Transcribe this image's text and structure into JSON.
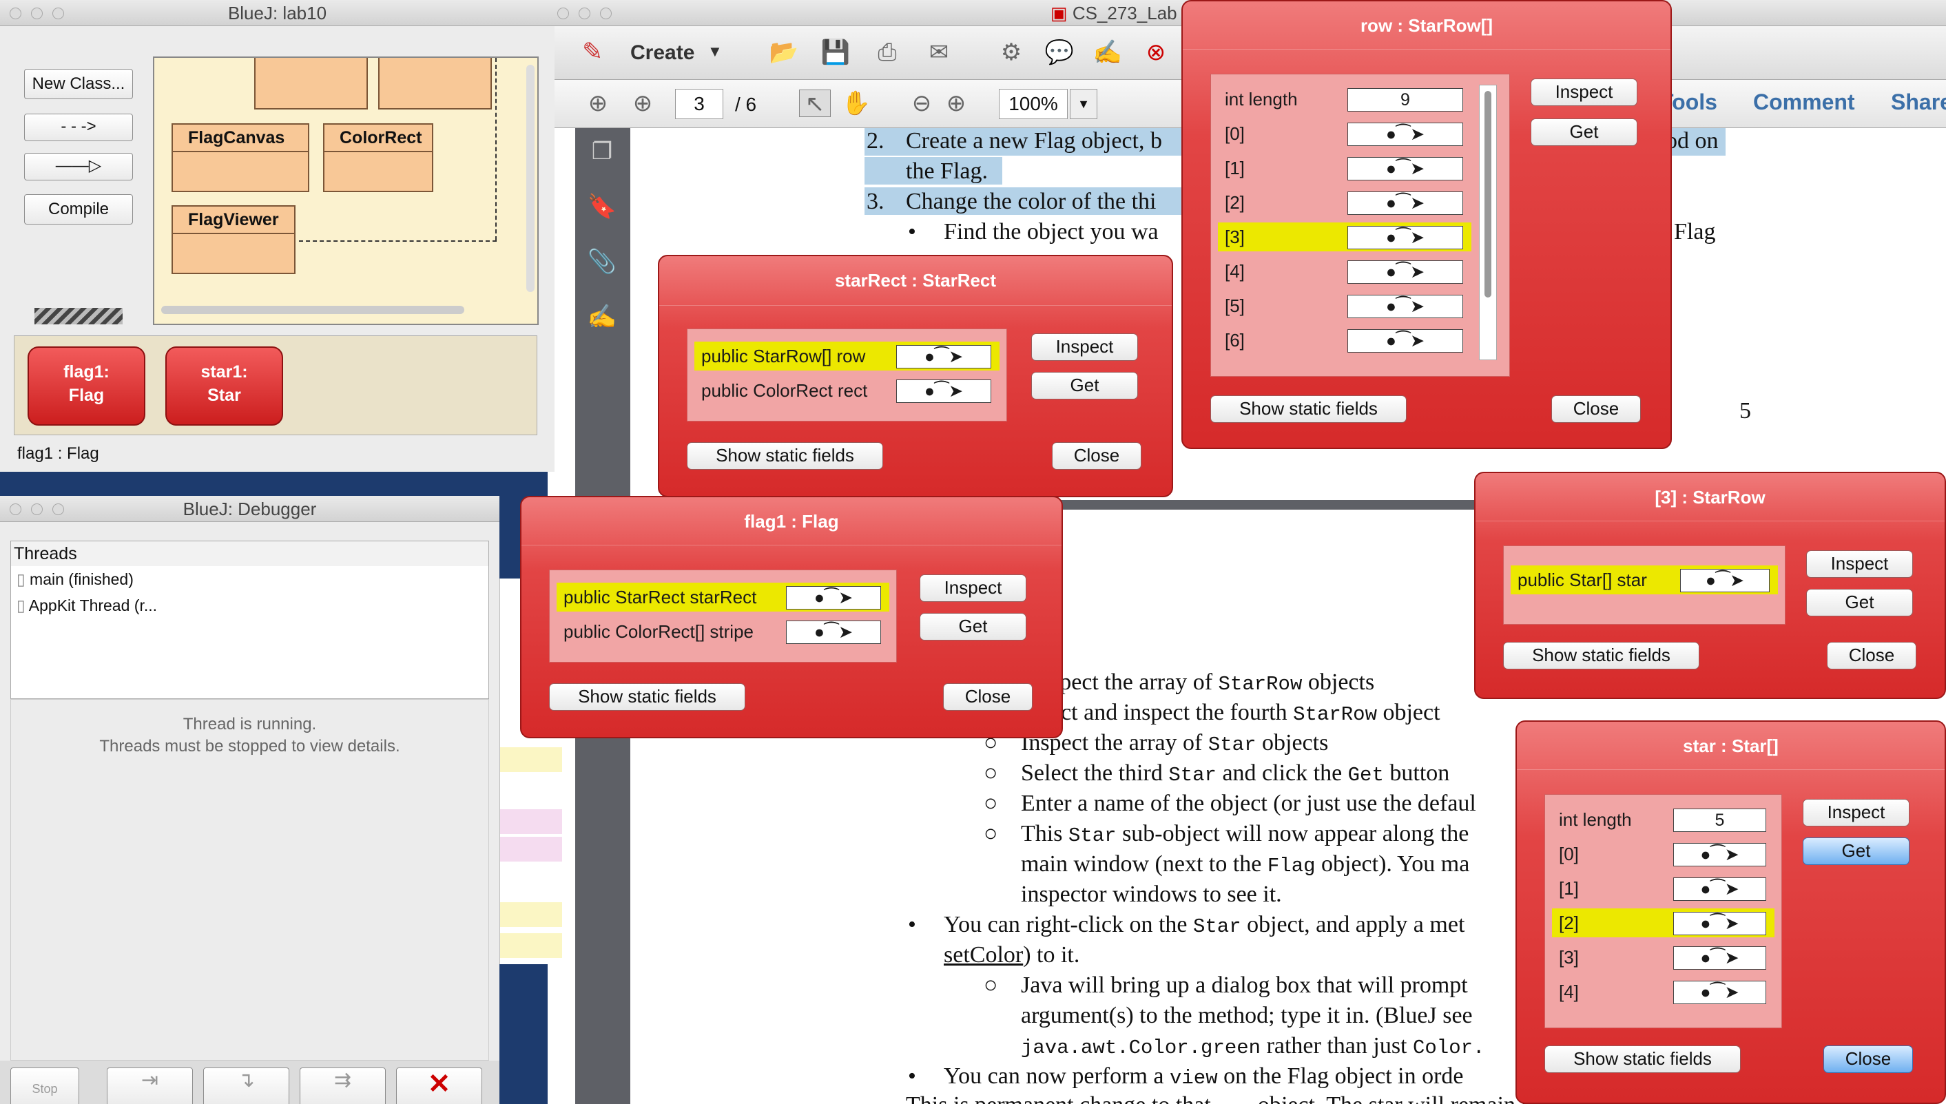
{
  "bluej": {
    "title": "BlueJ:  lab10",
    "new_class": "New Class...",
    "compile": "Compile",
    "classes": [
      "FlagCanvas",
      "ColorRect",
      "FlagViewer"
    ],
    "objects": [
      {
        "name": "flag1:",
        "type": "Flag"
      },
      {
        "name": "star1:",
        "type": "Star"
      }
    ],
    "status": "flag1 : Flag"
  },
  "debugger": {
    "title": "BlueJ:  Debugger",
    "threads_header": "Threads",
    "threads": [
      "main (finished)",
      "AppKit Thread (r..."
    ],
    "msg1": "Thread is running.",
    "msg2": "Threads must be stopped to view details.",
    "stop": "Stop"
  },
  "acrobat": {
    "title": "CS_273_Lab",
    "create": "Create",
    "page": "3",
    "page_total": "/ 6",
    "zoom": "100%",
    "tools": "Tools",
    "comment": "Comment",
    "share": "Share",
    "doc": {
      "l2a": "2.",
      "l2b": "Create a new Flag object, b",
      "l2c": "od on",
      "l2d": "the Flag.",
      "l3a": "3.",
      "l3b": "Change the color of the thi",
      "b1": "Find the object you wa",
      "b1end": "Flag",
      "pnum": "5",
      "s1": "spect the array of ",
      "s1m": "StarRow",
      "s1e": " objects",
      "s2": "ect and inspect the fourth ",
      "s2m": "StarRow",
      "s2e": " object",
      "s3": "Inspect the array of ",
      "s3m": "Star",
      "s3e": " objects",
      "s4": "Select the third ",
      "s4m": "Star",
      "s4b": " and click the ",
      "s4m2": "Get",
      "s4e": " button",
      "s5": "Enter a name of the object (or just use the defaul",
      "s6": "This ",
      "s6m": "Star",
      "s6e": " sub-object will now appear along the",
      "s7": "main window (next to the ",
      "s7m": "Flag",
      "s7e": " object). You ma",
      "s8": "inspector windows to see it.",
      "b2": "You can right-click on the ",
      "b2m": "Star",
      "b2e": " object, and apply a met",
      "b2b": "setColor",
      "b2c": ") to it.",
      "s9": "Java will bring up a dialog box that will prompt",
      "s10": "argument(s) to the method; type it in. (BlueJ see",
      "s11m": "java.awt.Color.green",
      "s11": " rather than just ",
      "s11m2": "Color.",
      "b3": "You can now perform a ",
      "b3m": "view",
      "b3e": " on the Flag object in orde",
      "b4": "This is permanent change to that ___ object. The star will remain green until that"
    }
  },
  "common": {
    "inspect": "Inspect",
    "get": "Get",
    "show_static": "Show static fields",
    "close": "Close"
  },
  "row_insp": {
    "title": "row : StarRow[]",
    "len_label": "int length",
    "len": "9",
    "items": [
      "[0]",
      "[1]",
      "[2]",
      "[3]",
      "[4]",
      "[5]",
      "[6]"
    ]
  },
  "starrect_insp": {
    "title": "starRect : StarRect",
    "f1": "public StarRow[] row",
    "f2": "public ColorRect rect"
  },
  "flag_insp": {
    "title": "flag1 : Flag",
    "f1": "public StarRect starRect",
    "f2": "public ColorRect[] stripe"
  },
  "starrow_insp": {
    "title": "[3] : StarRow",
    "f1": "public Star[] star"
  },
  "star_insp": {
    "title": "star : Star[]",
    "len_label": "int length",
    "len": "5",
    "items": [
      "[0]",
      "[1]",
      "[2]",
      "[3]",
      "[4]"
    ]
  }
}
